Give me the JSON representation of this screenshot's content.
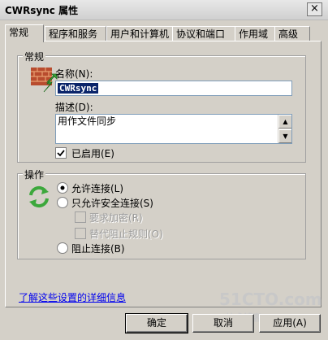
{
  "window": {
    "title": "CWRsync 属性",
    "close_glyph": "×"
  },
  "tabs": [
    {
      "label": "常规",
      "active": true
    },
    {
      "label": "程序和服务",
      "active": false
    },
    {
      "label": "用户和计算机",
      "active": false
    },
    {
      "label": "协议和端口",
      "active": false
    },
    {
      "label": "作用域",
      "active": false
    },
    {
      "label": "高级",
      "active": false
    }
  ],
  "general_group": {
    "legend": "常规",
    "name_label": "名称(N):",
    "name_value": "CWRsync",
    "desc_label": "描述(D):",
    "desc_value": "用作文件同步",
    "enabled_label": "已启用(E)",
    "enabled_checked": true,
    "icon": "firewall-rule-icon"
  },
  "action_group": {
    "legend": "操作",
    "icon": "refresh-arrows-icon",
    "allow_label": "允许连接(L)",
    "secure_label": "只允许安全连接(S)",
    "require_encrypt_label": "要求加密(R)",
    "override_block_label": "替代阻止规则(O)",
    "block_label": "阻止连接(B)",
    "selected": "allow"
  },
  "footer": {
    "learn_more_link": "了解这些设置的详细信息",
    "ok_label": "确定",
    "cancel_label": "取消",
    "apply_label": "应用(A)"
  },
  "watermark": {
    "site": "51CTO.com",
    "tagline": "技术博客 Blog"
  }
}
